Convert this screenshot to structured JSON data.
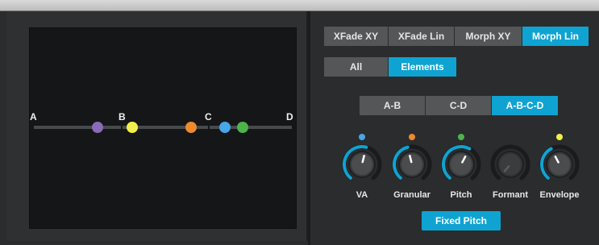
{
  "pad": {
    "corner_a": "A",
    "corner_b": "B",
    "corner_c": "C",
    "corner_d": "D",
    "dots": [
      {
        "name": "dot-purple",
        "color": "#8a6bb8"
      },
      {
        "name": "dot-yellow",
        "color": "#f3ef4a"
      },
      {
        "name": "dot-orange",
        "color": "#ee8a2e"
      },
      {
        "name": "dot-blue",
        "color": "#46a6e6"
      },
      {
        "name": "dot-green",
        "color": "#4cb54a"
      }
    ]
  },
  "modes": {
    "xfade_xy": "XFade XY",
    "xfade_lin": "XFade Lin",
    "morph_xy": "Morph XY",
    "morph_lin": "Morph Lin",
    "active": "Morph Lin"
  },
  "scope": {
    "all": "All",
    "elements": "Elements",
    "active": "Elements"
  },
  "path": {
    "ab": "A-B",
    "cd": "C-D",
    "abcd": "A-B-C-D",
    "active": "A-B-C-D"
  },
  "knobs": {
    "va": {
      "label": "VA",
      "dot_color": "#46a6e6",
      "level": 0.55,
      "active": true
    },
    "granular": {
      "label": "Granular",
      "dot_color": "#ee8a2e",
      "level": 0.45,
      "active": true
    },
    "pitch": {
      "label": "Pitch",
      "dot_color": "#4cb54a",
      "level": 0.6,
      "active": true
    },
    "formant": {
      "label": "Formant",
      "dot_color": "",
      "level": 0.0,
      "active": false
    },
    "envelope": {
      "label": "Envelope",
      "dot_color": "#f3ef4a",
      "level": 0.4,
      "active": true
    }
  },
  "fixed_pitch": "Fixed Pitch",
  "colors": {
    "accent": "#0fa3d2",
    "button_inactive": "#545658"
  }
}
